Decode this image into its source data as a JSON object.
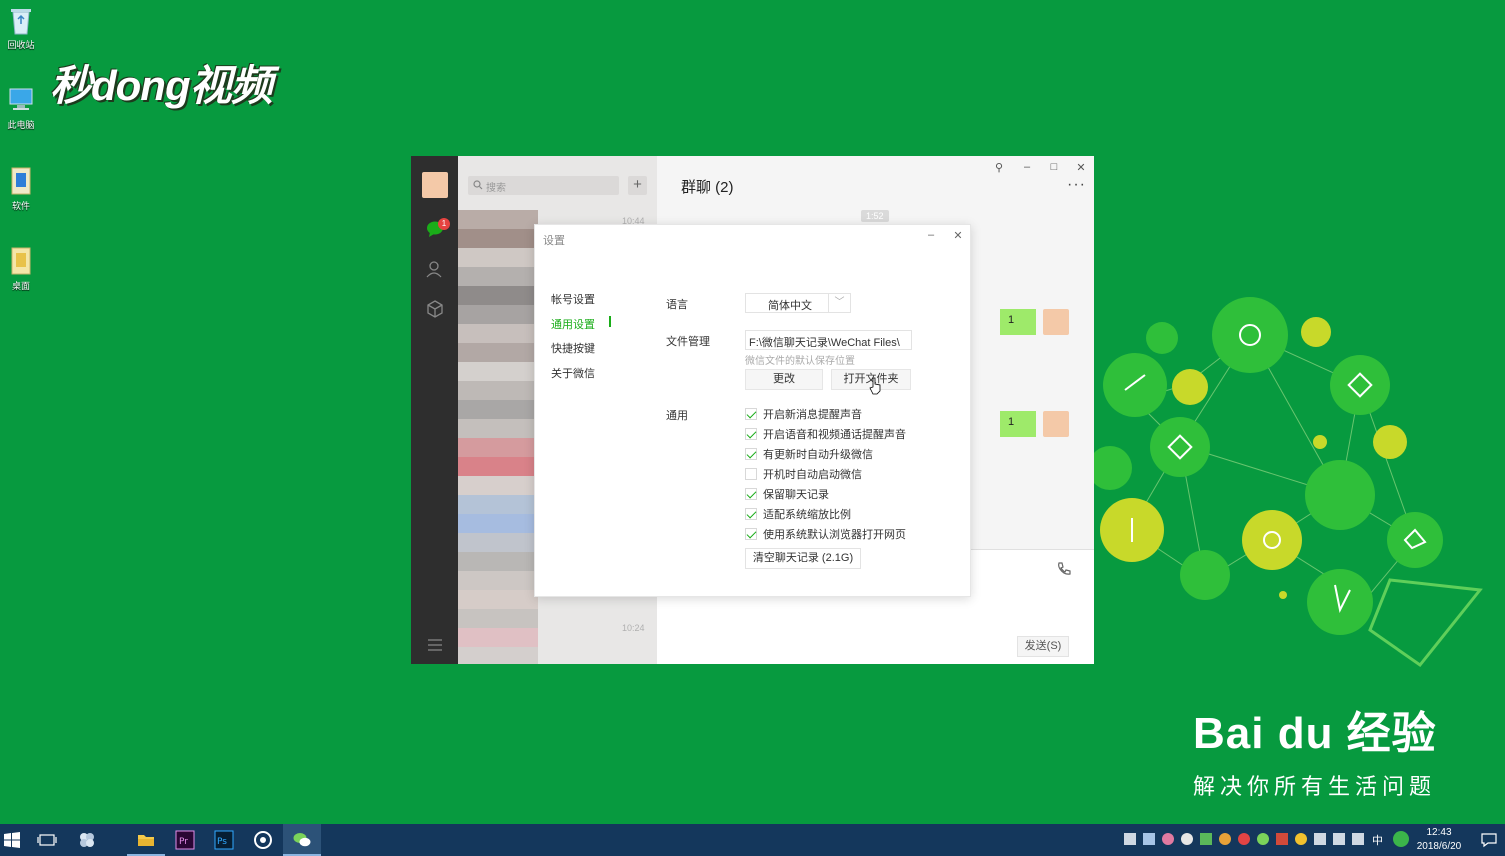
{
  "desktop": {
    "icons": [
      {
        "label": "回收站"
      },
      {
        "label": "此电脑"
      },
      {
        "label": "软件"
      },
      {
        "label": "桌面"
      }
    ],
    "watermark": "秒dong视频",
    "baidu": {
      "logo": "Bai du 经验",
      "slogan": "解决你所有生活问题"
    }
  },
  "wechat": {
    "search_placeholder": "搜索",
    "chat_title": "群聊 (2)",
    "chat_time": "1:52",
    "list_times": [
      "10:44",
      "10:24"
    ],
    "messages": [
      "1",
      "1"
    ],
    "send_label": "发送(S)",
    "unread_count": "1"
  },
  "settings": {
    "title": "设置",
    "nav": [
      {
        "label": "帐号设置"
      },
      {
        "label": "通用设置"
      },
      {
        "label": "快捷按键"
      },
      {
        "label": "关于微信"
      }
    ],
    "language_label": "语言",
    "language_value": "简体中文",
    "file_label": "文件管理",
    "file_path": "F:\\微信聊天记录\\WeChat Files\\",
    "file_hint": "微信文件的默认保存位置",
    "change_btn": "更改",
    "open_btn": "打开文件夹",
    "general_label": "通用",
    "options": [
      {
        "label": "开启新消息提醒声音",
        "checked": true
      },
      {
        "label": "开启语音和视频通话提醒声音",
        "checked": true
      },
      {
        "label": "有更新时自动升级微信",
        "checked": true
      },
      {
        "label": "开机时自动启动微信",
        "checked": false
      },
      {
        "label": "保留聊天记录",
        "checked": true
      },
      {
        "label": "适配系统缩放比例",
        "checked": true
      },
      {
        "label": "使用系统默认浏览器打开网页",
        "checked": true
      }
    ],
    "clear_btn": "清空聊天记录 (2.1G)"
  },
  "taskbar": {
    "time": "12:43",
    "date": "2018/6/20",
    "ime": "中"
  },
  "colors": {
    "desktop": "#079a3f",
    "wechat_green": "#1aad19",
    "bubble": "#9eea6a",
    "taskbar": "#14375c"
  }
}
